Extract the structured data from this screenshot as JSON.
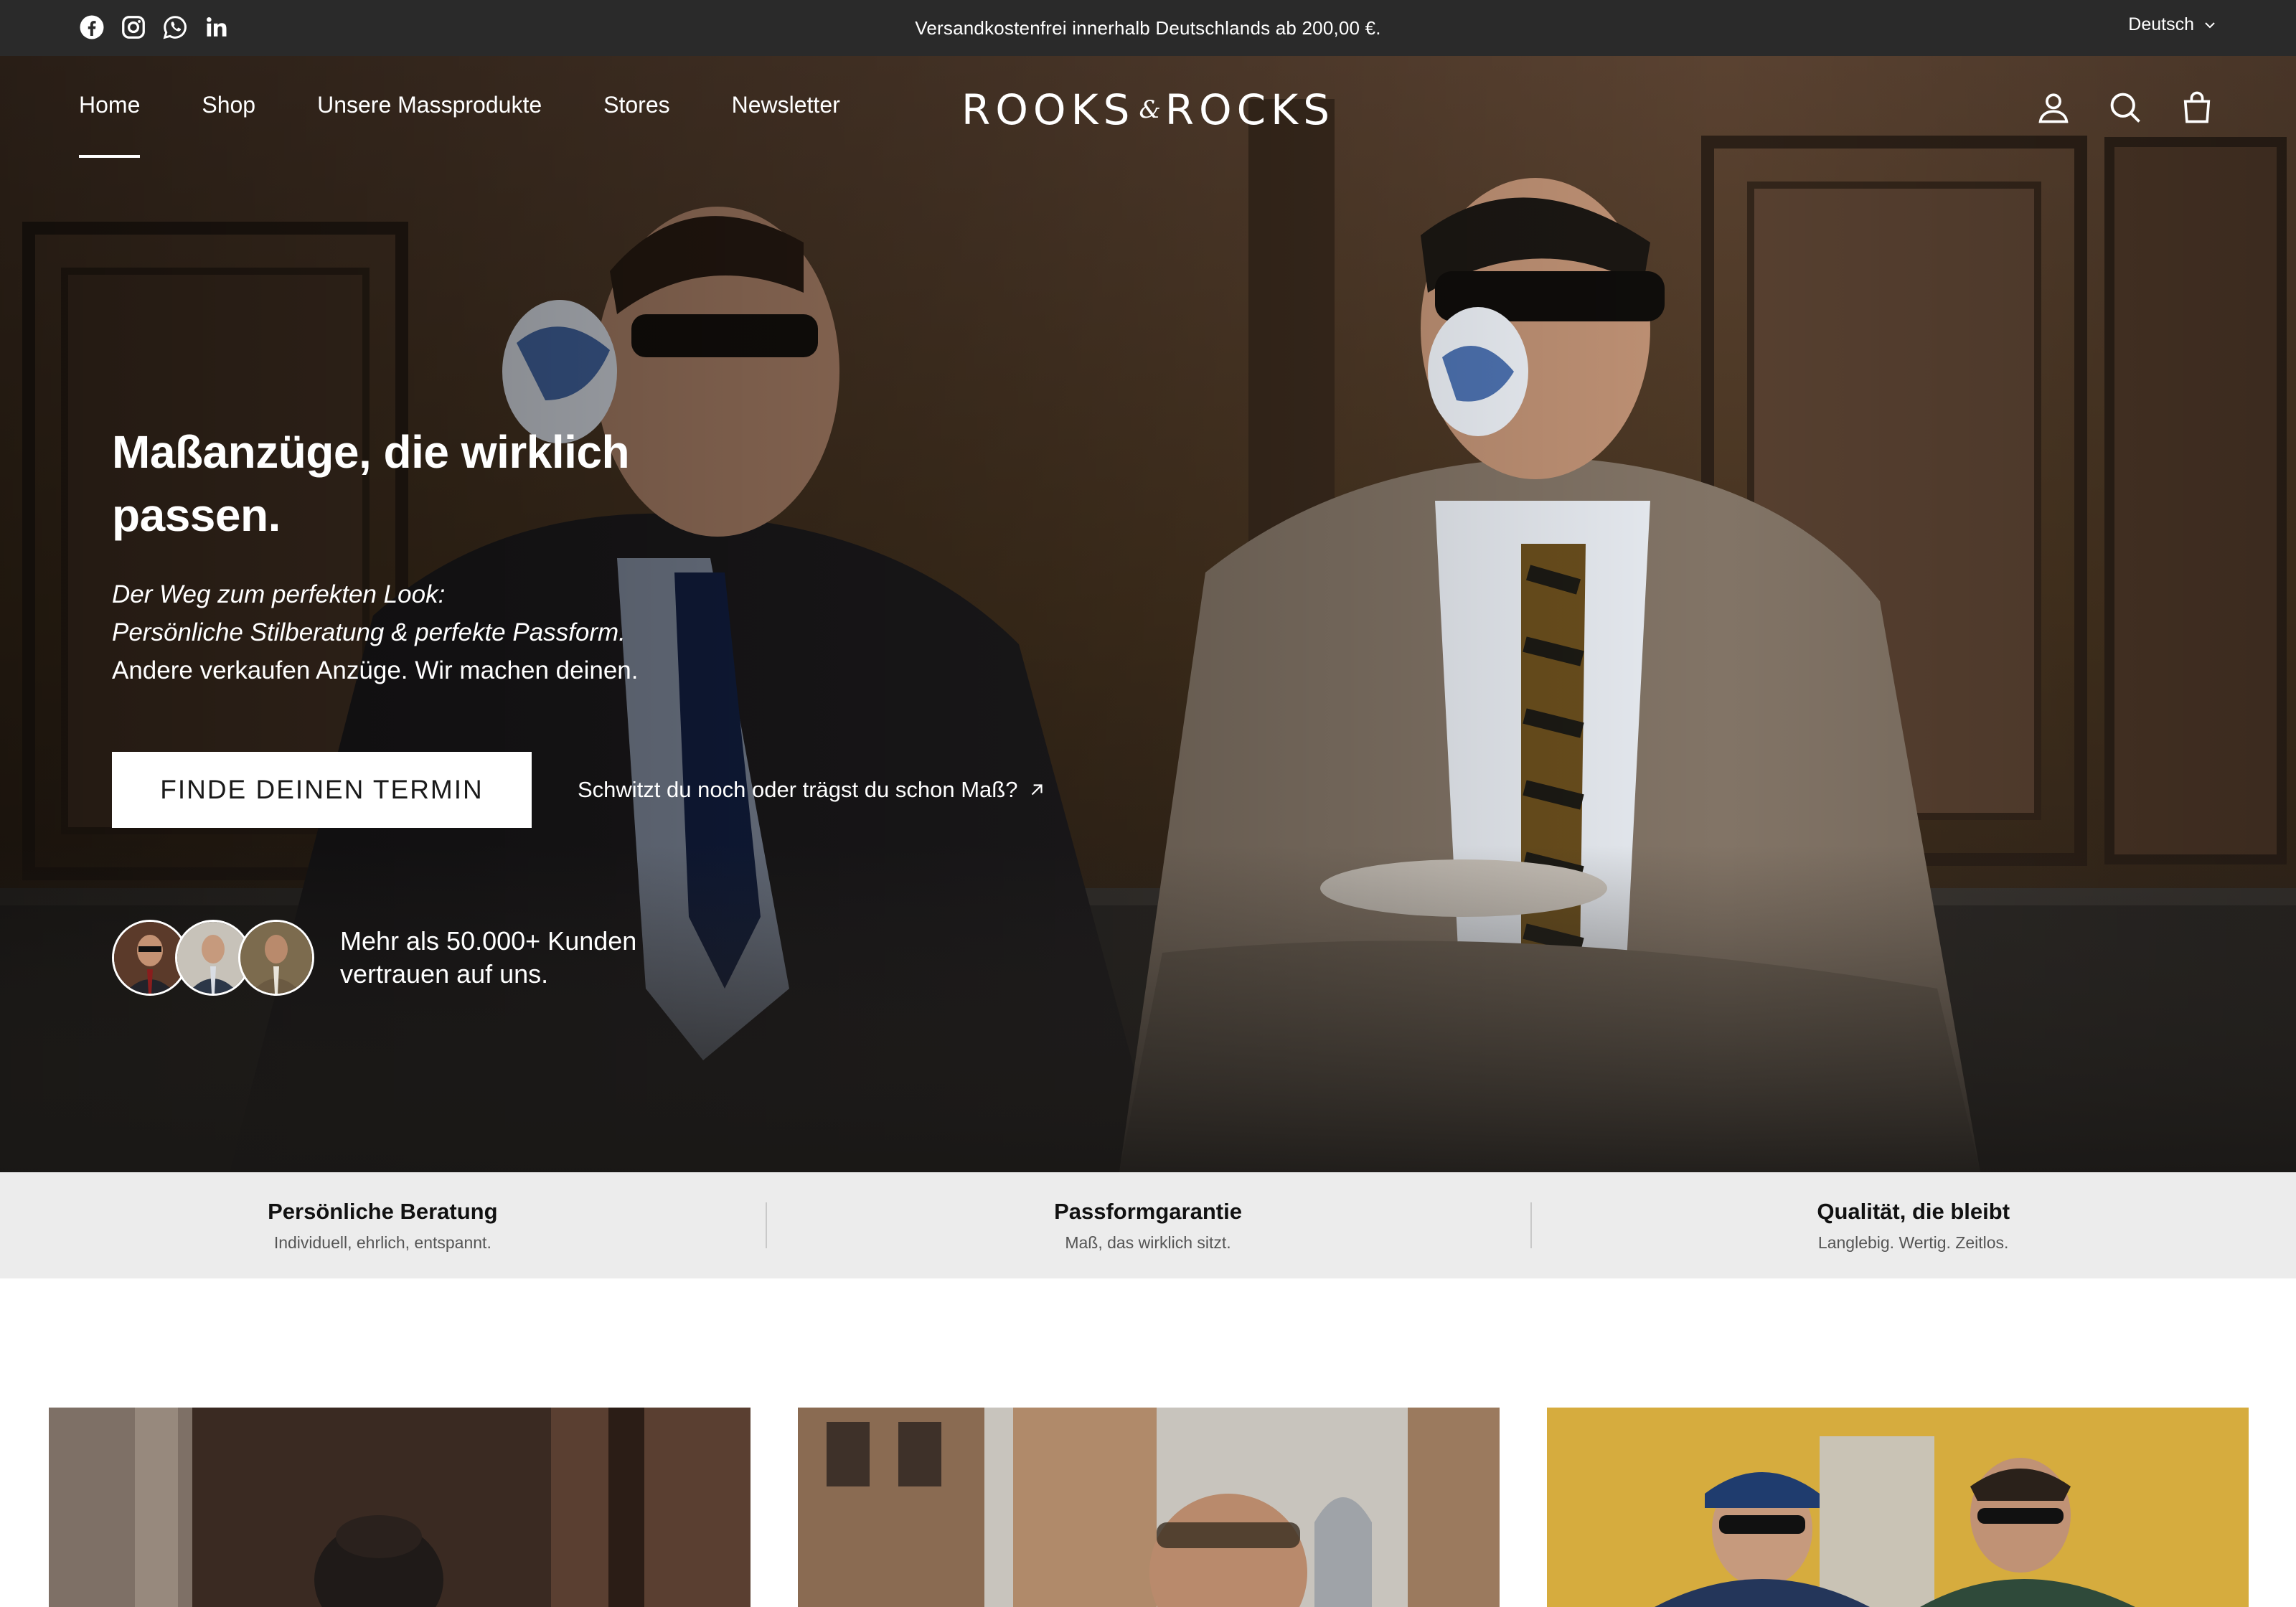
{
  "announcement": {
    "message": "Versandkostenfrei innerhalb Deutschlands ab 200,00 €.",
    "language": "Deutsch",
    "socials": [
      "facebook-icon",
      "instagram-icon",
      "whatsapp-icon",
      "linkedin-icon"
    ]
  },
  "nav": {
    "items": [
      {
        "label": "Home",
        "active": true
      },
      {
        "label": "Shop",
        "active": false
      },
      {
        "label": "Unsere Massprodukte",
        "active": false
      },
      {
        "label": "Stores",
        "active": false
      },
      {
        "label": "Newsletter",
        "active": false
      }
    ],
    "logo": {
      "left": "ROOKS",
      "amp": "&",
      "right": "ROCKS"
    },
    "icons": [
      "account-icon",
      "search-icon",
      "cart-icon"
    ]
  },
  "hero": {
    "title_line1": "Maßanzüge, die wirklich",
    "title_line2": "passen.",
    "sub_italic_1": "Der Weg zum perfekten Look:",
    "sub_italic_2": "Persönliche Stilberatung & perfekte Passform.",
    "sub_plain": "Andere verkaufen Anzüge. Wir machen deinen.",
    "cta_label": "FINDE DEINEN TERMIN",
    "secondary_link": "Schwitzt du noch oder trägst du schon Maß?",
    "trust_line1": "Mehr als 50.000+ Kunden",
    "trust_line2": "vertrauen auf uns."
  },
  "usps": [
    {
      "title": "Persönliche Beratung",
      "desc": "Individuell, ehrlich, entspannt."
    },
    {
      "title": "Passformgarantie",
      "desc": "Maß, das wirklich sitzt."
    },
    {
      "title": "Qualität, die bleibt",
      "desc": "Langlebig. Wertig. Zeitlos."
    }
  ],
  "colors": {
    "announcement_bg": "#2a2a2a",
    "usp_bg": "#ececec",
    "cta_bg": "#ffffff"
  }
}
